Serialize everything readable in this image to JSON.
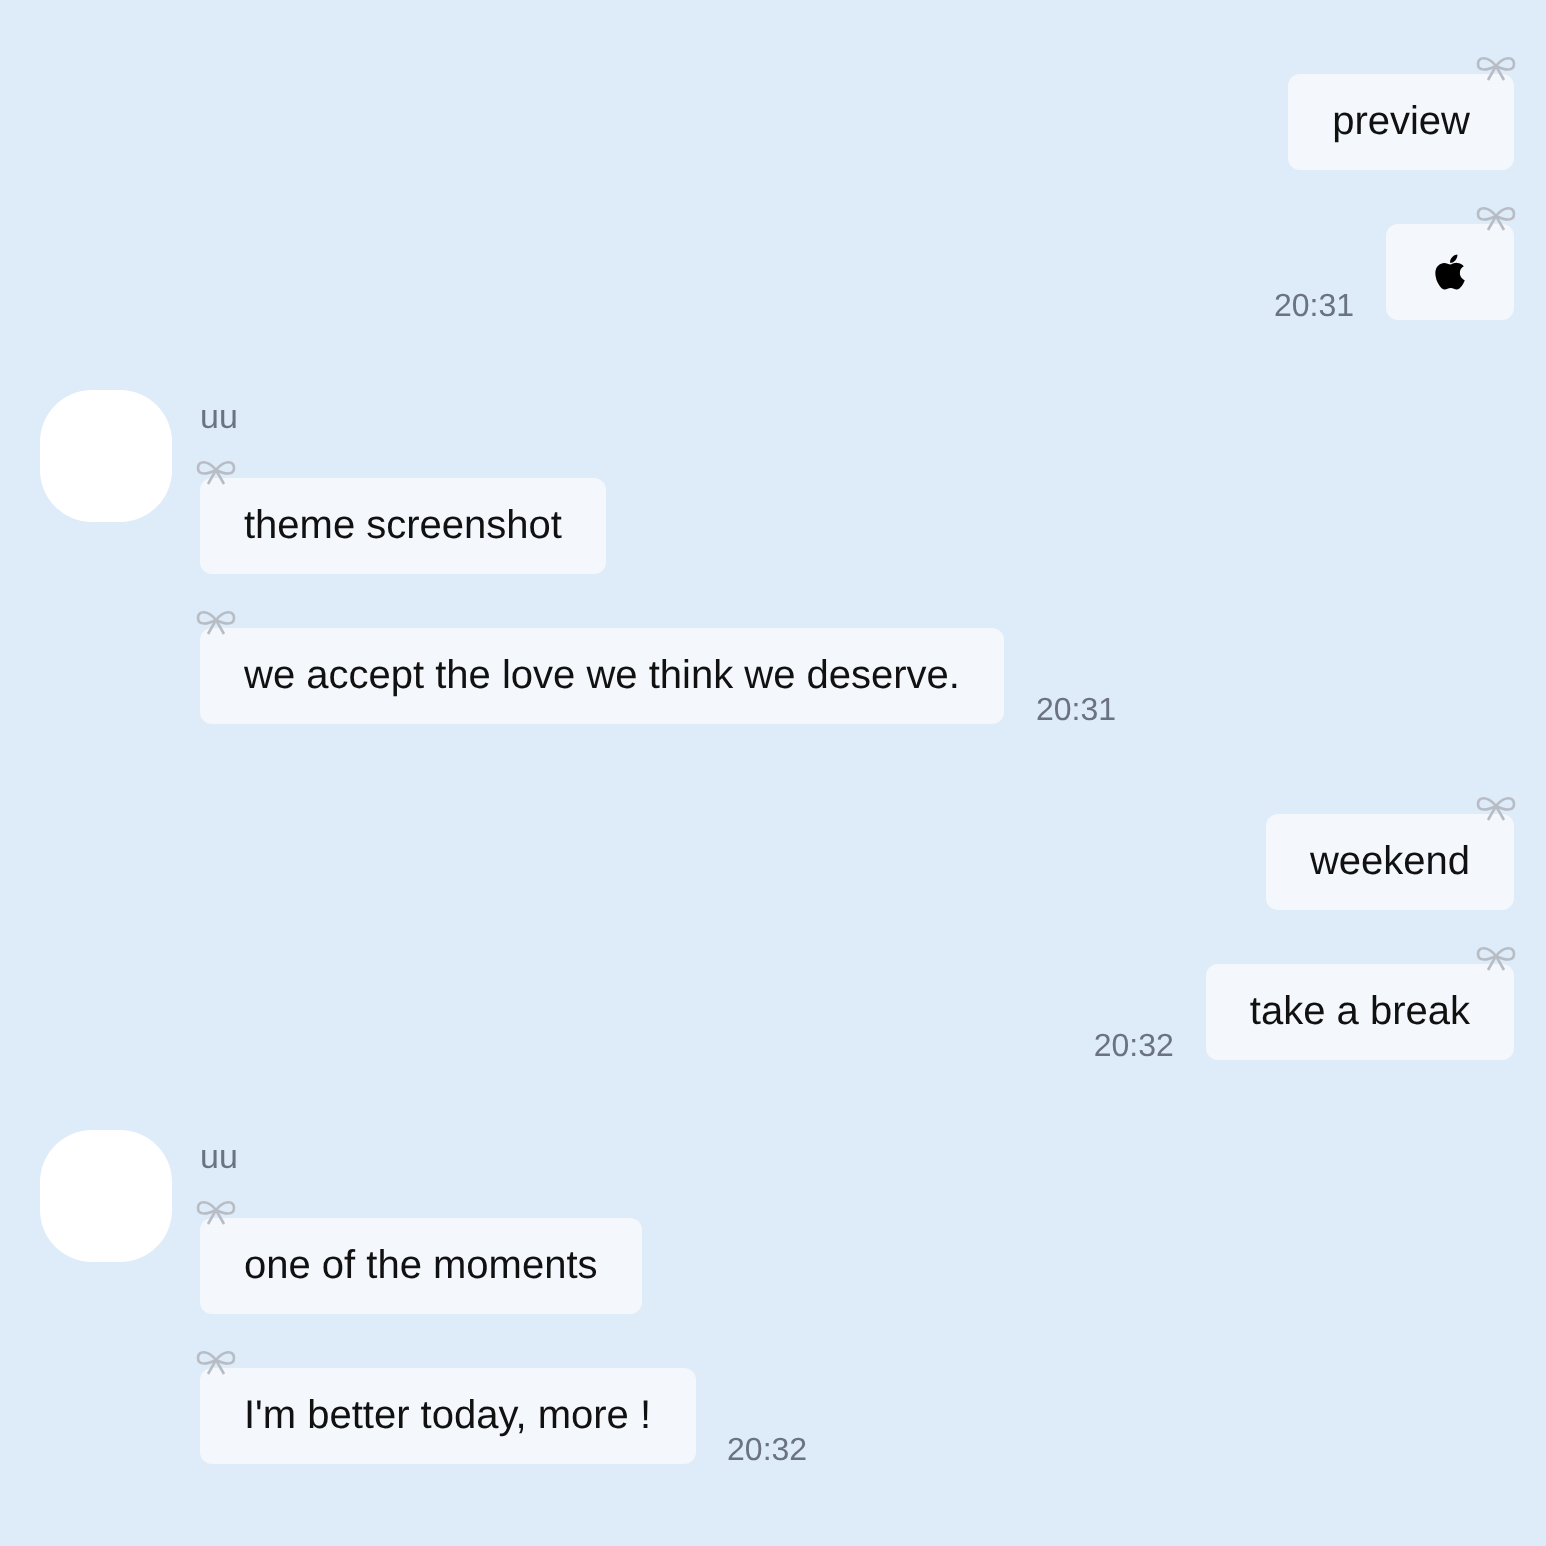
{
  "groups": [
    {
      "kind": "outgoing",
      "messages": [
        {
          "kind": "text",
          "text": "preview"
        },
        {
          "kind": "apple",
          "time": "20:31"
        }
      ]
    },
    {
      "kind": "incoming",
      "sender": "uu",
      "messages": [
        {
          "kind": "text",
          "text": "theme screenshot"
        },
        {
          "kind": "text",
          "text": "we accept the love we think we deserve.",
          "time": "20:31"
        }
      ]
    },
    {
      "kind": "outgoing",
      "messages": [
        {
          "kind": "text",
          "text": "weekend"
        },
        {
          "kind": "text",
          "text": "take a break",
          "time": "20:32"
        }
      ]
    },
    {
      "kind": "incoming",
      "sender": "uu",
      "messages": [
        {
          "kind": "text",
          "text": "one of the moments"
        },
        {
          "kind": "text",
          "text": "I'm better today, more !",
          "time": "20:32"
        }
      ]
    }
  ]
}
